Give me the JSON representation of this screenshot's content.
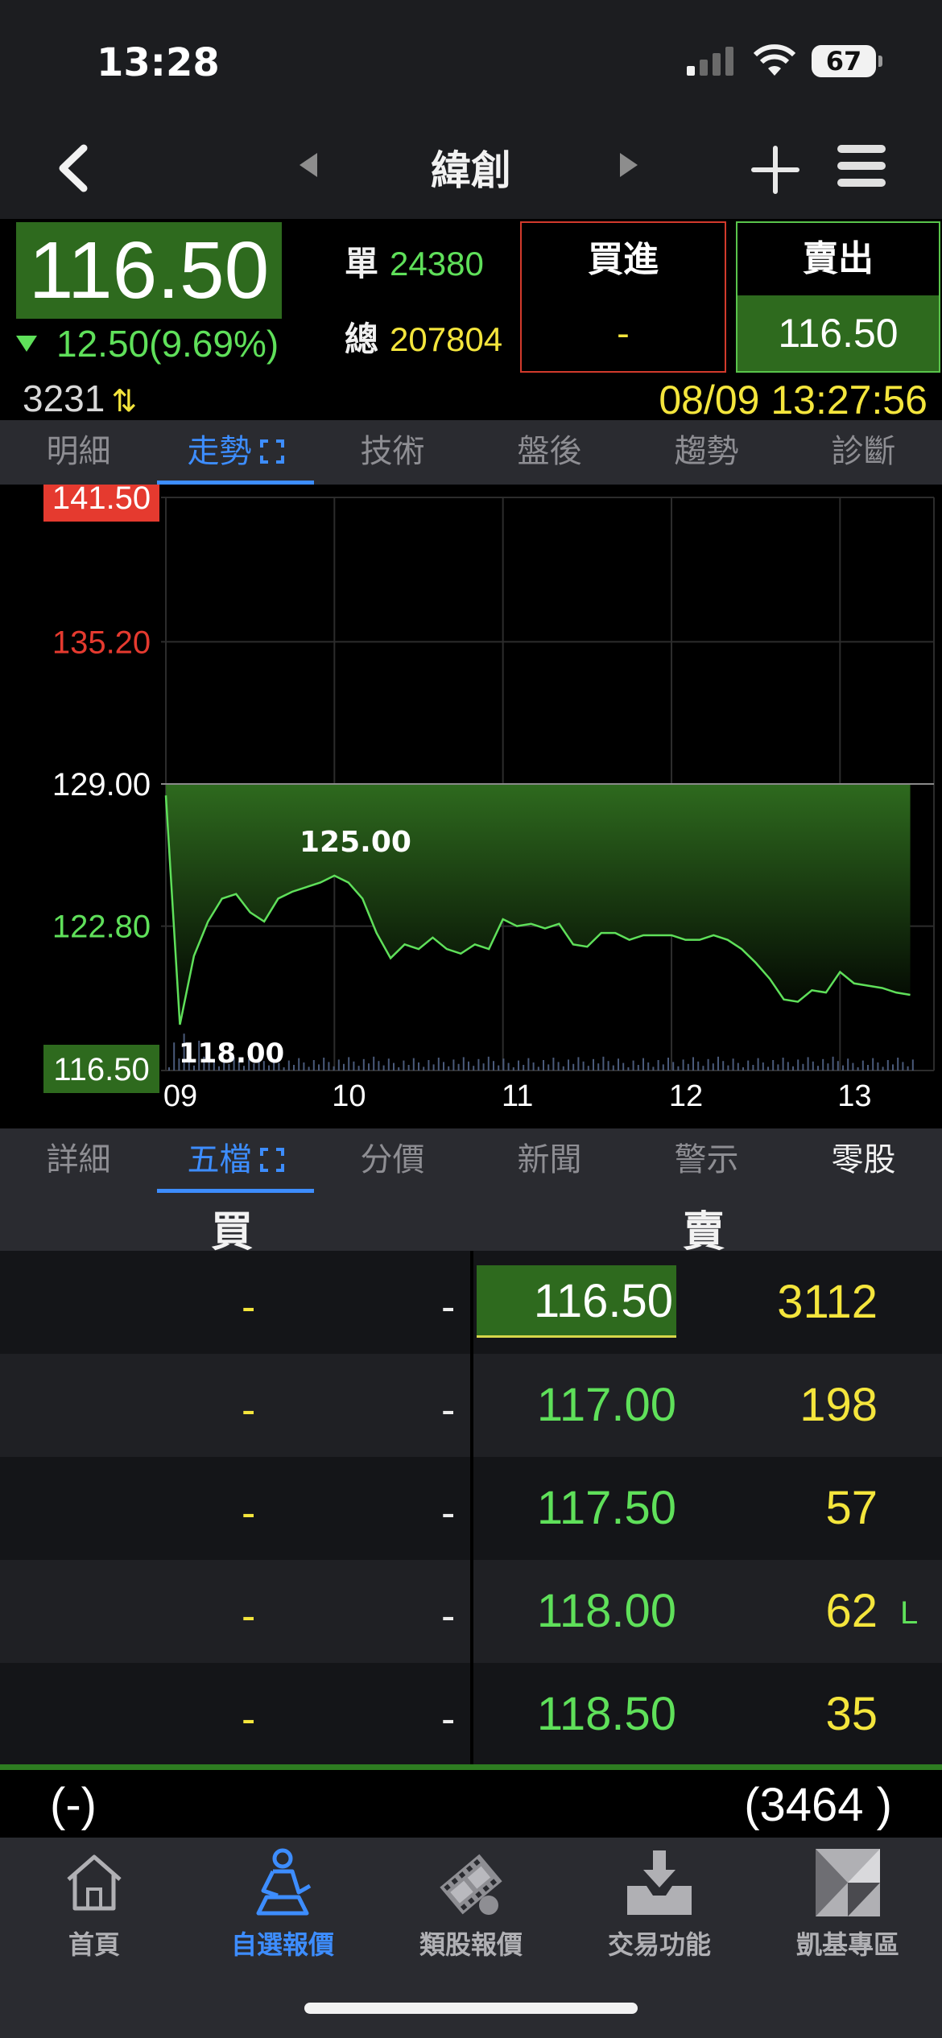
{
  "status": {
    "time": "13:28",
    "battery": "67"
  },
  "nav": {
    "title": "緯創"
  },
  "quote": {
    "price": "116.50",
    "change": "12.50",
    "change_pct": "(9.69%)",
    "single_label": "單",
    "single_vol": "24380",
    "total_label": "總",
    "total_vol": "207804",
    "buy_label": "買進",
    "buy_value": "-",
    "sell_label": "賣出",
    "sell_value": "116.50",
    "code": "3231",
    "datetime": "08/09 13:27:56"
  },
  "tabs_top": [
    "明細",
    "走勢",
    "技術",
    "盤後",
    "趨勢",
    "診斷"
  ],
  "tabs_bottom": [
    "詳細",
    "五檔",
    "分價",
    "新聞",
    "警示",
    "零股"
  ],
  "chart_data": {
    "type": "area",
    "y_ticks": [
      "141.50",
      "135.20",
      "129.00",
      "122.80",
      "116.50"
    ],
    "x_ticks": [
      "09",
      "10",
      "11",
      "12",
      "13"
    ],
    "ylim": [
      116.5,
      141.5
    ],
    "reference_price": 129.0,
    "annotations": {
      "high": "125.00",
      "low": "118.00"
    },
    "x": [
      "09:00",
      "09:05",
      "09:10",
      "09:15",
      "09:20",
      "09:25",
      "09:30",
      "09:35",
      "09:40",
      "09:45",
      "09:50",
      "09:55",
      "10:00",
      "10:05",
      "10:10",
      "10:15",
      "10:20",
      "10:25",
      "10:30",
      "10:35",
      "10:40",
      "10:45",
      "10:50",
      "10:55",
      "11:00",
      "11:05",
      "11:10",
      "11:15",
      "11:20",
      "11:25",
      "11:30",
      "11:35",
      "11:40",
      "11:45",
      "11:50",
      "11:55",
      "12:00",
      "12:05",
      "12:10",
      "12:15",
      "12:20",
      "12:25",
      "12:30",
      "12:35",
      "12:40",
      "12:45",
      "12:50",
      "12:55",
      "13:00",
      "13:05",
      "13:10",
      "13:15",
      "13:20",
      "13:25"
    ],
    "values": [
      128.5,
      118.5,
      121.5,
      123.0,
      124.0,
      124.2,
      123.4,
      123.0,
      124.0,
      124.3,
      124.5,
      124.7,
      125.0,
      124.7,
      124.0,
      122.5,
      121.4,
      122.0,
      121.8,
      122.3,
      121.8,
      121.6,
      122.0,
      121.8,
      123.1,
      122.8,
      122.9,
      122.7,
      122.9,
      122.0,
      121.9,
      122.5,
      122.5,
      122.2,
      122.4,
      122.4,
      122.4,
      122.2,
      122.2,
      122.4,
      122.2,
      121.8,
      121.2,
      120.5,
      119.6,
      119.5,
      120.0,
      119.9,
      120.8,
      120.3,
      120.2,
      120.1,
      119.9,
      119.8
    ],
    "colors": {
      "line": "#5fe05a",
      "fill_top": "#2e6a1e",
      "high_tick": "#e53a2f",
      "low_tick": "#5fe05a"
    }
  },
  "order_book": {
    "buy_header": "買",
    "sell_header": "賣",
    "rows": [
      {
        "buy_qty": "-",
        "buy_price": "-",
        "sell_price": "116.50",
        "sell_qty": "3112",
        "flag": ""
      },
      {
        "buy_qty": "-",
        "buy_price": "-",
        "sell_price": "117.00",
        "sell_qty": "198",
        "flag": ""
      },
      {
        "buy_qty": "-",
        "buy_price": "-",
        "sell_price": "117.50",
        "sell_qty": "57",
        "flag": ""
      },
      {
        "buy_qty": "-",
        "buy_price": "-",
        "sell_price": "118.00",
        "sell_qty": "62",
        "flag": "L"
      },
      {
        "buy_qty": "-",
        "buy_price": "-",
        "sell_price": "118.50",
        "sell_qty": "35",
        "flag": ""
      }
    ],
    "buy_total": "(-)",
    "sell_total": "(3464 )"
  },
  "bottom_nav": [
    {
      "label": "首頁",
      "icon": "home-icon"
    },
    {
      "label": "自選報價",
      "icon": "trader-icon"
    },
    {
      "label": "類股報價",
      "icon": "film-icon"
    },
    {
      "label": "交易功能",
      "icon": "download-tray-icon"
    },
    {
      "label": "凱基專區",
      "icon": "kgi-logo-icon"
    }
  ]
}
